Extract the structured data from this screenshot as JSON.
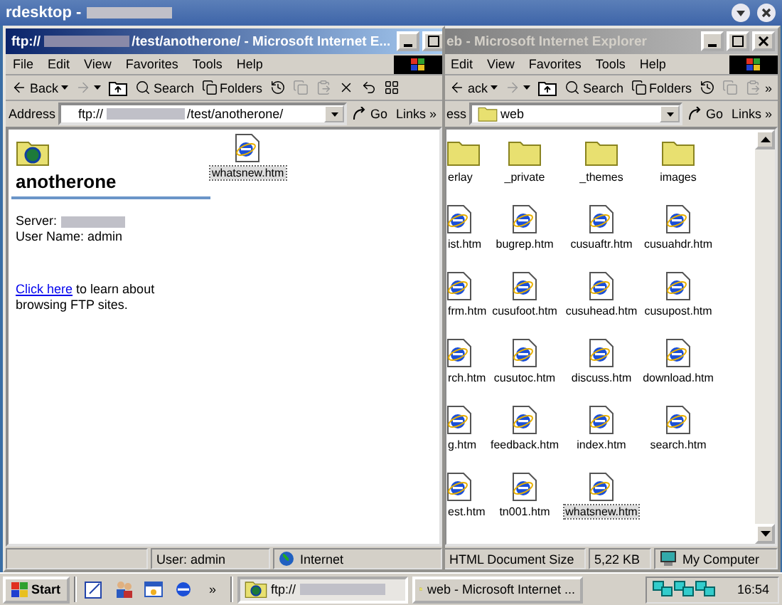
{
  "rdesktop": {
    "title": "rdesktop -"
  },
  "front_window": {
    "title_prefix": "ftp://",
    "title_suffix": "/test/anotherone/ - Microsoft Internet E...",
    "active": true,
    "menu": [
      "File",
      "Edit",
      "View",
      "Favorites",
      "Tools",
      "Help"
    ],
    "toolbar": [
      {
        "kind": "back",
        "label": "Back"
      },
      {
        "kind": "forward"
      },
      {
        "kind": "up"
      },
      {
        "kind": "search",
        "label": "Search"
      },
      {
        "kind": "folders",
        "label": "Folders"
      },
      {
        "kind": "history"
      },
      {
        "kind": "copy"
      },
      {
        "kind": "paste"
      },
      {
        "kind": "delete"
      },
      {
        "kind": "undo"
      },
      {
        "kind": "views"
      }
    ],
    "address": {
      "label": "Address",
      "prefix": "ftp://",
      "suffix": "/test/anotherone/"
    },
    "go": "Go",
    "links": "Links",
    "links_chevron": "»",
    "folder_title": "anotherone",
    "server_label": "Server:",
    "user_line": "User Name: admin",
    "link": "Click here",
    "link_rest": "to learn about browsing FTP sites.",
    "files": [
      {
        "name": "whatsnew.htm",
        "selected": true
      }
    ],
    "status": [
      "User: admin",
      "Internet"
    ]
  },
  "back_window": {
    "title": "eb - Microsoft Internet Explorer",
    "active": false,
    "menu": [
      "Edit",
      "View",
      "Favorites",
      "Tools",
      "Help"
    ],
    "toolbar": [
      {
        "kind": "back",
        "label": "ack"
      },
      {
        "kind": "forward"
      },
      {
        "kind": "up"
      },
      {
        "kind": "search",
        "label": "Search"
      },
      {
        "kind": "folders",
        "label": "Folders"
      },
      {
        "kind": "history"
      },
      {
        "kind": "copy"
      },
      {
        "kind": "paste"
      }
    ],
    "toolbar_chevron": "»",
    "address": {
      "label": "ess",
      "value": "web"
    },
    "go": "Go",
    "links": "Links",
    "links_chevron": "»",
    "files": [
      {
        "kind": "folder",
        "name": "erlay",
        "selected": false
      },
      {
        "kind": "folder",
        "name": "_private",
        "selected": false
      },
      {
        "kind": "folder",
        "name": "_themes",
        "selected": false
      },
      {
        "kind": "folder",
        "name": "images",
        "selected": false
      },
      {
        "kind": "htm",
        "name": "ist.htm",
        "selected": false
      },
      {
        "kind": "htm",
        "name": "bugrep.htm",
        "selected": false
      },
      {
        "kind": "htm",
        "name": "cusuaftr.htm",
        "selected": false
      },
      {
        "kind": "htm",
        "name": "cusuahdr.htm",
        "selected": false
      },
      {
        "kind": "htm",
        "name": "frm.htm",
        "selected": false
      },
      {
        "kind": "htm",
        "name": "cusufoot.htm",
        "selected": false
      },
      {
        "kind": "htm",
        "name": "cusuhead.htm",
        "selected": false
      },
      {
        "kind": "htm",
        "name": "cusupost.htm",
        "selected": false
      },
      {
        "kind": "htm",
        "name": "rch.htm",
        "selected": false
      },
      {
        "kind": "htm",
        "name": "cusutoc.htm",
        "selected": false
      },
      {
        "kind": "htm",
        "name": "discuss.htm",
        "selected": false
      },
      {
        "kind": "htm",
        "name": "download.htm",
        "selected": false
      },
      {
        "kind": "htm",
        "name": "g.htm",
        "selected": false
      },
      {
        "kind": "htm",
        "name": "feedback.htm",
        "selected": false
      },
      {
        "kind": "htm",
        "name": "index.htm",
        "selected": false
      },
      {
        "kind": "htm",
        "name": "search.htm",
        "selected": false
      },
      {
        "kind": "htm",
        "name": "est.htm",
        "selected": false
      },
      {
        "kind": "htm",
        "name": "tn001.htm",
        "selected": false
      },
      {
        "kind": "htm",
        "name": "whatsnew.htm",
        "selected": true
      }
    ],
    "status": [
      "HTML Document Size",
      "5,22 KB",
      "My Computer"
    ]
  },
  "taskbar": {
    "start": "Start",
    "chevron": "»",
    "tasks": [
      {
        "label": "ftp://",
        "redacted": true,
        "selected": true
      },
      {
        "label": "web - Microsoft Internet ...",
        "redacted": false,
        "selected": false
      }
    ],
    "clock": "16:54"
  }
}
